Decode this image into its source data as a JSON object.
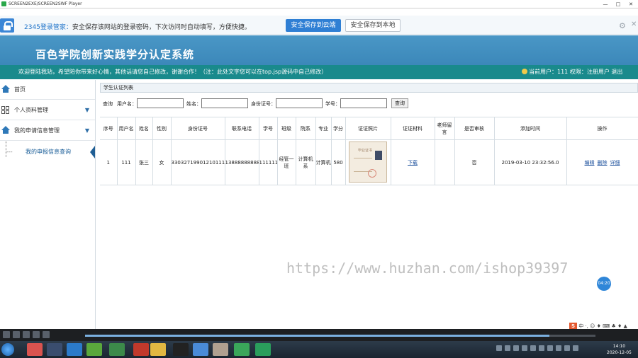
{
  "window": {
    "title": "SCREEN2EXE/SCREEN2SWF Player",
    "buttons": [
      "—",
      "□",
      "✕"
    ]
  },
  "password_bar": {
    "brand": "2345登录管家：",
    "message": "安全保存该网站的登录密码，下次访问时自动填写，方便快捷。",
    "save_cloud_label": "安全保存到云端",
    "save_local_label": "安全保存到本地",
    "gear_glyph": "⚙",
    "close_glyph": "✕"
  },
  "header": {
    "title": "百色学院创新实践学分认定系统",
    "welcome": "欢迎登陆我站，希望陪你带来好心情，其他话请您自己修改，谢谢合作！（注：此处文字您可以在top.jsp源码中自己修改）",
    "user_info": "当前用户：111",
    "role_info": "权限：注册用户 退出"
  },
  "sidebar": {
    "items": [
      {
        "label": "首页",
        "icon": "home-icon"
      },
      {
        "label": "个人资料管理",
        "icon": "grid-icon"
      },
      {
        "label": "我的申请信息管理",
        "icon": "home-icon"
      }
    ],
    "sub_item": "我的申报信息查询"
  },
  "content": {
    "panel_title": "学生认证列表",
    "query": {
      "prefix": "查询",
      "username_label": "用户名：",
      "name_label": "姓名：",
      "idcard_label": "身份证号：",
      "studentno_label": "学号：",
      "search_button": "查询"
    },
    "table": {
      "columns": [
        "序号",
        "用户名",
        "姓名",
        "性别",
        "身份证号",
        "联系电话",
        "学号",
        "班级",
        "院系",
        "专业",
        "学分",
        "证证照片",
        "证证材料",
        "老师留言",
        "是否审核",
        "添加时间",
        "操作"
      ],
      "rows": [
        {
          "index": "1",
          "username": "111",
          "name": "张三",
          "gender": "女",
          "idcard": "330327199012101111",
          "phone": "13888888888",
          "student_no": "111111",
          "class_name": "经管一班",
          "department": "计算机系",
          "major": "计算机",
          "credits": "580",
          "photo_title": "毕业证书",
          "material": "下载",
          "teacher_msg": "",
          "reviewed": "否",
          "added_time": "2019-03-10 23:32:56.0",
          "ops": [
            "编辑",
            "删除",
            "详细"
          ]
        }
      ]
    }
  },
  "overlay": {
    "watermark": "https://www.huzhan.com/ishop39397",
    "time_badge": "04:20"
  },
  "ime_bar": {
    "text": "中 ·, ☺ ♦ ⌨ ♣ ♦ ▲"
  },
  "taskbar": {
    "time": "14:10",
    "date": "2020-12-05"
  },
  "colors": {
    "header": "#3b87b9",
    "welcome_bar": "#198a8c",
    "primary_button": "#2f7fd4",
    "link": "#1b4f9c"
  },
  "player": {
    "progress_fraction": 0.91
  }
}
